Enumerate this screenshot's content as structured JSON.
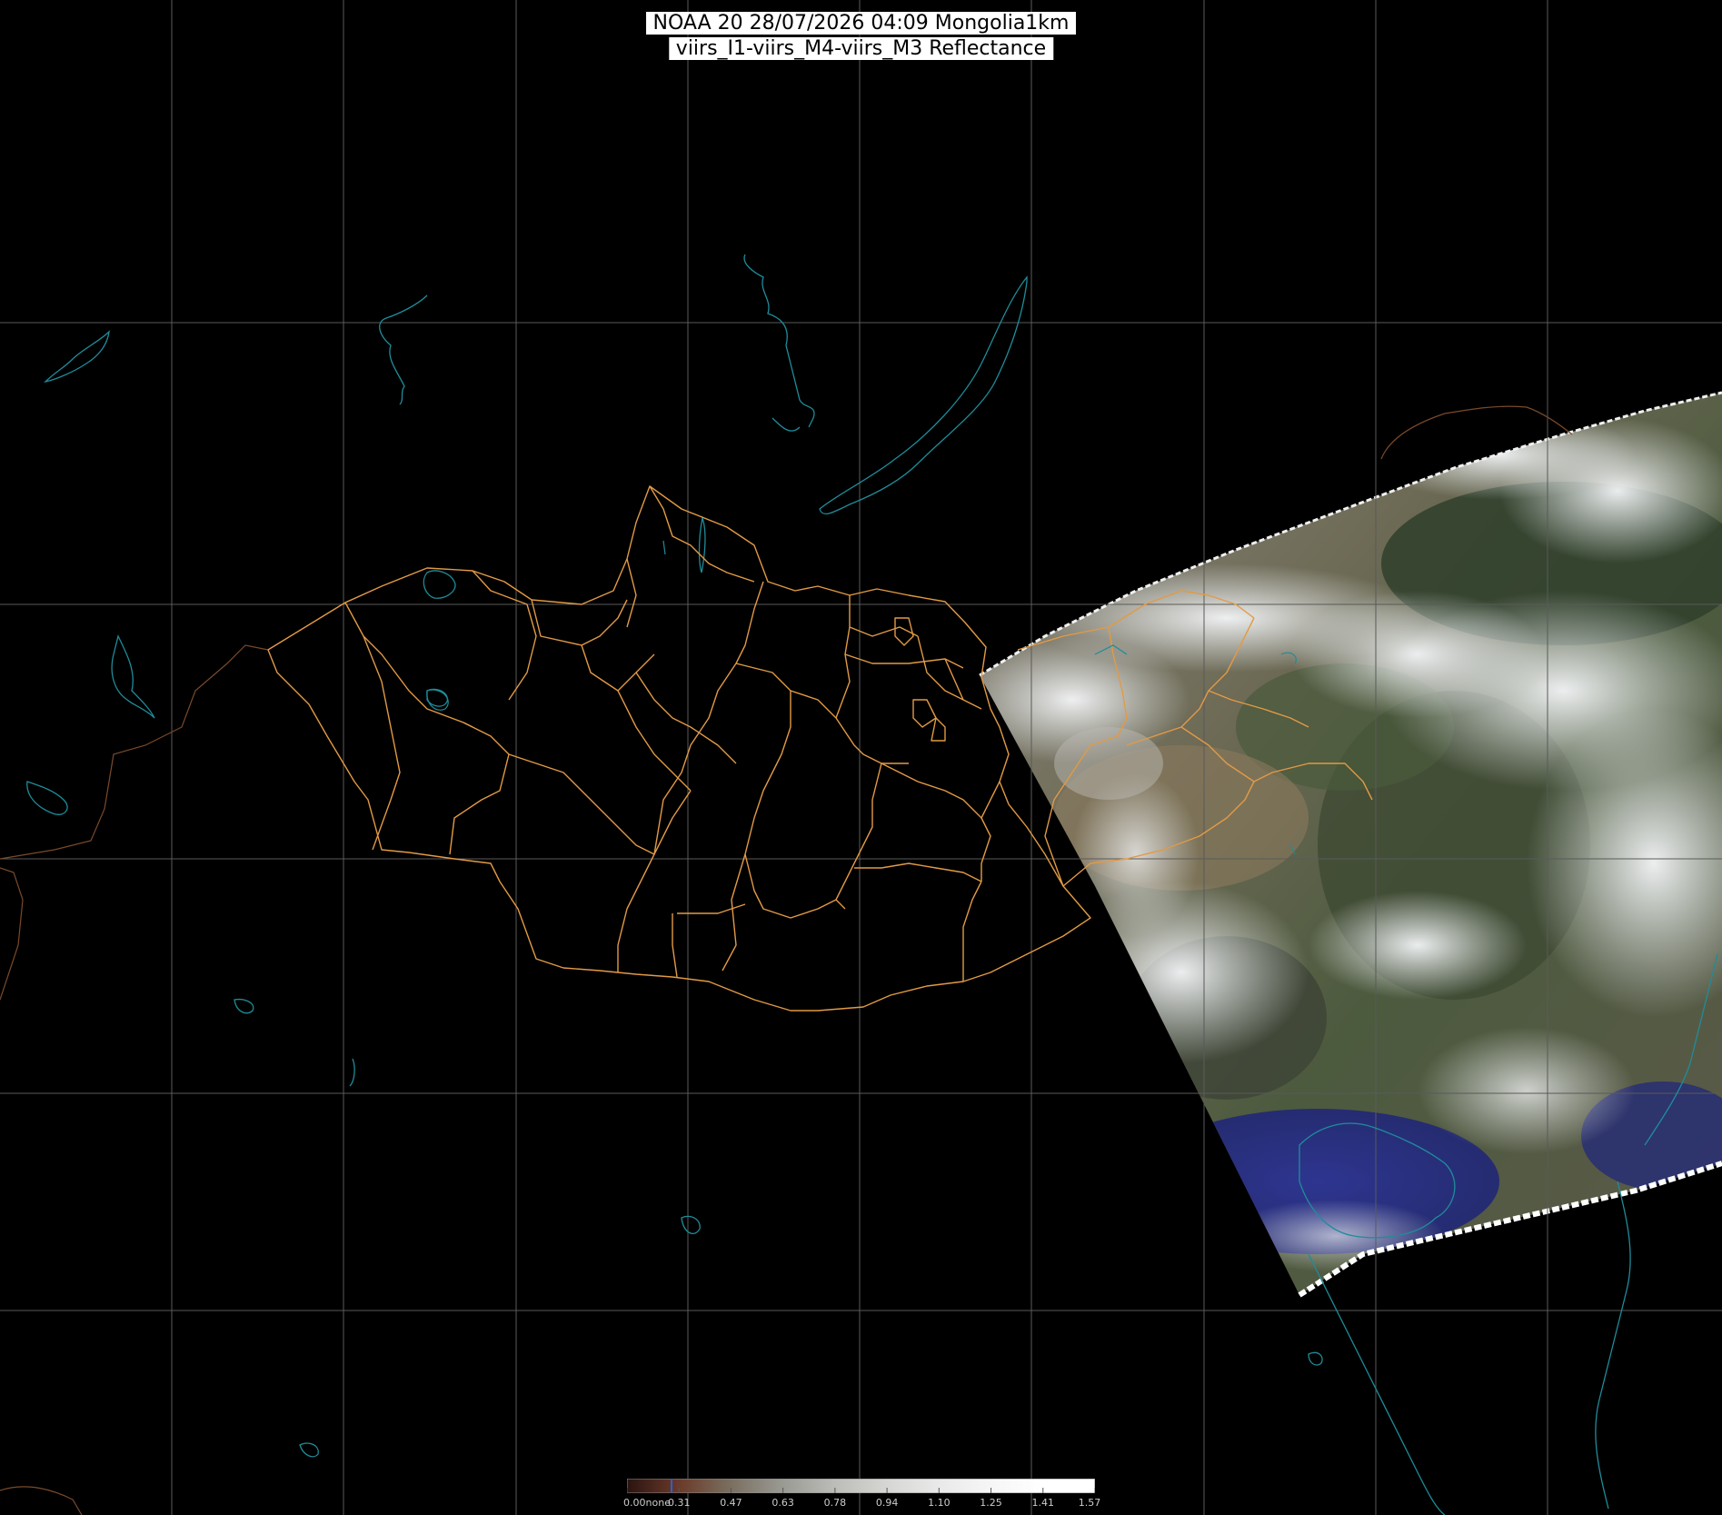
{
  "map": {
    "title_line_1": "NOAA 20 28/07/2026 04:09 Mongolia1km",
    "title_line_2": "viirs_I1-viirs_M4-viirs_M3 Reflectance",
    "colors": {
      "background": "#000000",
      "graticule": "#5a5a5a",
      "admin_boundary": "#e29a45",
      "coastline_water": "#1f8c9a",
      "cloud": "#e8ecef",
      "land_green": "#3f5236",
      "land_brown": "#7a6a52",
      "sea": "#2b2f7a"
    }
  },
  "legend": {
    "labels": [
      "0.00none",
      "0.31",
      "0.47",
      "0.63",
      "0.78",
      "0.94",
      "1.10",
      "1.25",
      "1.41",
      "1.57"
    ],
    "colors": [
      "#2a1410",
      "#6b3a2a",
      "#7a7060",
      "#9a9a94",
      "#bcbcb8",
      "#d6d6d4",
      "#e9e9e9",
      "#f6f6f6",
      "#ffffff",
      "#ffffff"
    ]
  }
}
